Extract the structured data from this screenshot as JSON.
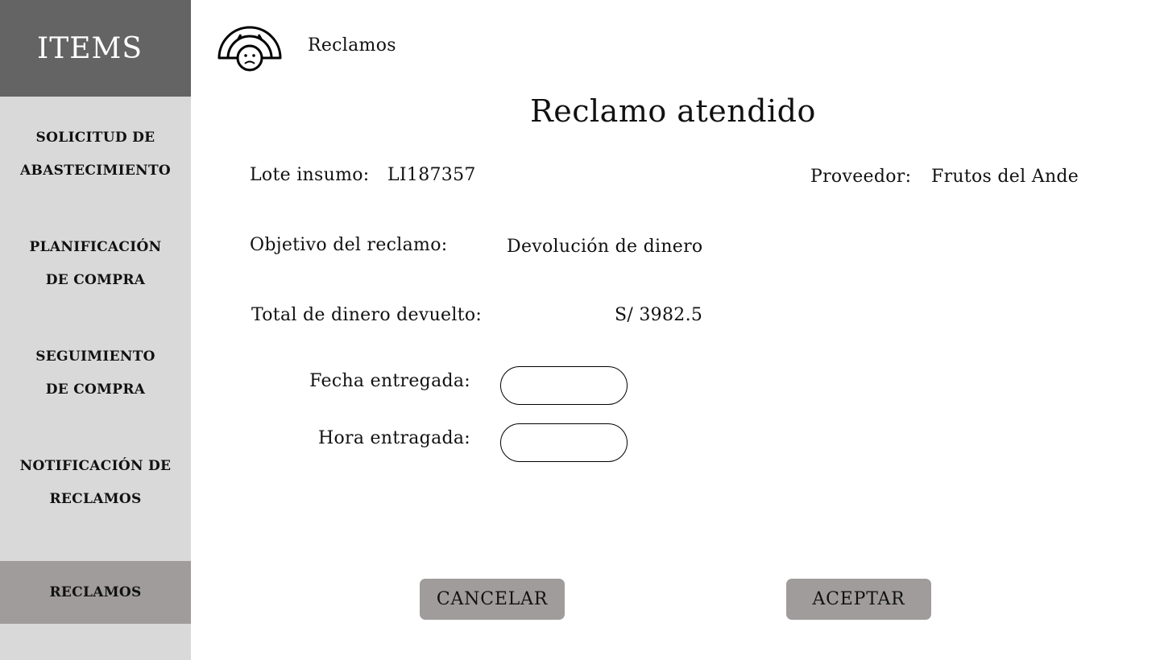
{
  "sidebar": {
    "title": "ITEMS",
    "items": [
      {
        "line1": "SOLICITUD DE",
        "line2": "ABASTECIMIENTO"
      },
      {
        "line1": "PLANIFICACIÓN",
        "line2": "DE COMPRA"
      },
      {
        "line1": "SEGUIMIENTO",
        "line2": "DE COMPRA"
      },
      {
        "line1": "NOTIFICACIÓN DE",
        "line2": "RECLAMOS"
      },
      {
        "label": "RECLAMOS",
        "active": true
      }
    ]
  },
  "header": {
    "logo_icon": "sad-face-arc-icon",
    "page_label": "Reclamos"
  },
  "main": {
    "title": "Reclamo atendido",
    "lote_label": "Lote insumo:",
    "lote_value": "LI187357",
    "proveedor_label": "Proveedor:",
    "proveedor_value": "Frutos del Ande",
    "objetivo_label": "Objetivo del reclamo:",
    "objetivo_value": "Devolución de dinero",
    "total_label": "Total de dinero devuelto:",
    "total_value": "S/ 3982.5",
    "fecha_label": "Fecha entregada:",
    "fecha_value": "",
    "hora_label": "Hora entragada:",
    "hora_value": ""
  },
  "buttons": {
    "cancel": "CANCELAR",
    "accept": "ACEPTAR"
  },
  "colors": {
    "sidebar_bg": "#d9d9d9",
    "sidebar_header_bg": "#646464",
    "active_item_bg": "#a09c9c",
    "button_bg": "#a09c9c"
  }
}
